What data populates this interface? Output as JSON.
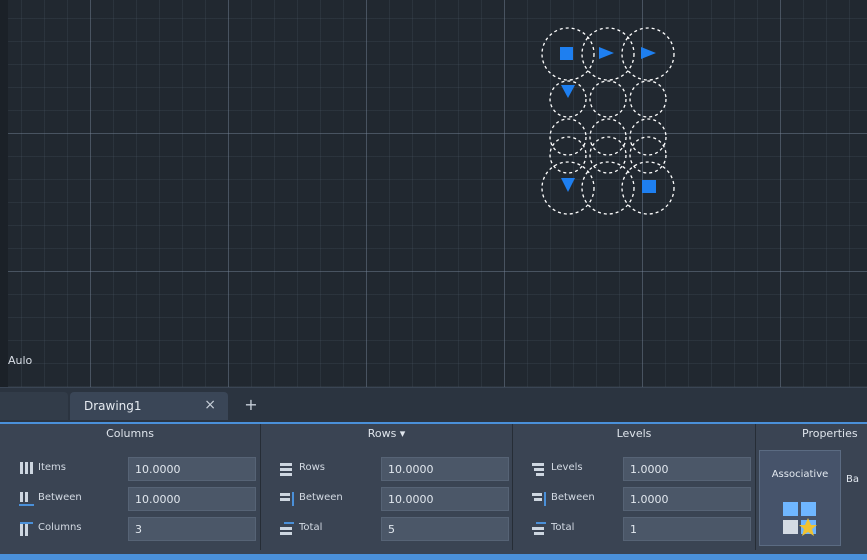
{
  "canvas": {
    "ucs_label": "Aulo",
    "grid_color": "#7b879b"
  },
  "tabs": {
    "active": "Drawing1",
    "close_glyph": "×",
    "add_glyph": "+"
  },
  "ribbon": {
    "columns": {
      "title": "Columns",
      "rows": [
        {
          "label": "Items",
          "value": "10.0000",
          "icon": "columns-count-icon"
        },
        {
          "label": "Between",
          "value": "10.0000",
          "icon": "columns-between-icon"
        },
        {
          "label": "Columns",
          "value": "3",
          "icon": "columns-total-icon"
        }
      ]
    },
    "rows": {
      "title": "Rows ▾",
      "rows": [
        {
          "label": "Rows",
          "value": "10.0000",
          "icon": "rows-count-icon"
        },
        {
          "label": "Between",
          "value": "10.0000",
          "icon": "rows-between-icon"
        },
        {
          "label": "Total",
          "value": "5",
          "icon": "rows-total-icon"
        }
      ]
    },
    "levels": {
      "title": "Levels",
      "rows": [
        {
          "label": "Levels",
          "value": "1.0000",
          "icon": "levels-count-icon"
        },
        {
          "label": "Between",
          "value": "1.0000",
          "icon": "levels-between-icon"
        },
        {
          "label": "Total",
          "value": "1",
          "icon": "levels-total-icon"
        }
      ]
    },
    "properties": {
      "title": "Properties",
      "associative_label": "Associative",
      "basepoint_label": "Ba"
    },
    "accent": "#4a90d9"
  }
}
